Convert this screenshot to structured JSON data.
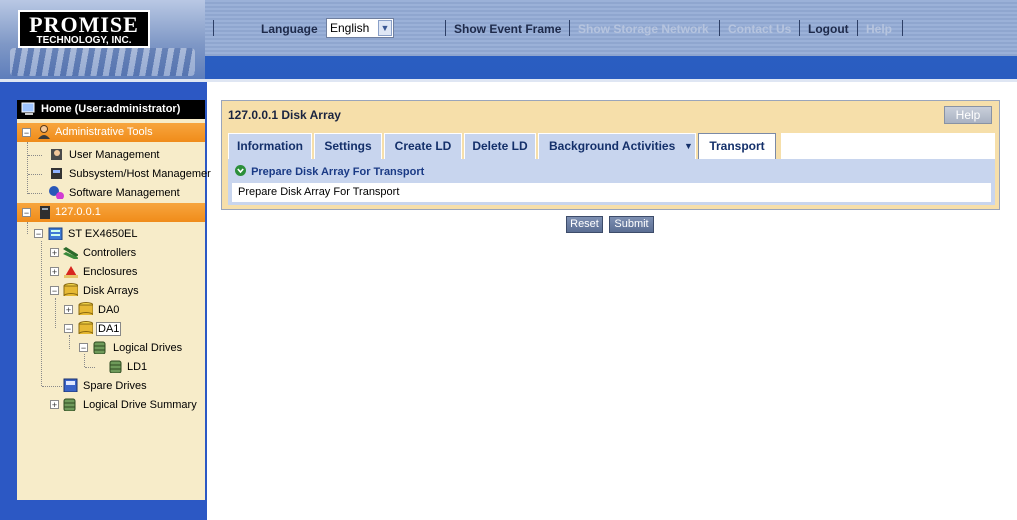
{
  "header": {
    "logo": {
      "line1": "PROMISE",
      "line2": "TECHNOLOGY, INC."
    },
    "language_label": "Language",
    "language_value": "English",
    "nav": [
      {
        "label": "Show Event Frame",
        "enabled": true
      },
      {
        "label": "Show Storage Network",
        "enabled": false
      },
      {
        "label": "Contact Us",
        "enabled": false
      },
      {
        "label": "Logout",
        "enabled": true
      },
      {
        "label": "Help",
        "enabled": false
      }
    ]
  },
  "sidebar": {
    "home": "Home (User:administrator)",
    "admin_tools": "Administrative Tools",
    "admin_items": [
      "User Management",
      "Subsystem/Host Managemer",
      "Software Management"
    ],
    "host": "127.0.0.1",
    "tree": {
      "subsystem": "ST EX4650EL",
      "controllers": "Controllers",
      "enclosures": "Enclosures",
      "disk_arrays": "Disk Arrays",
      "da0": "DA0",
      "da1": "DA1",
      "logical_drives": "Logical Drives",
      "ld1": "LD1",
      "spare_drives": "Spare Drives",
      "ld_summary": "Logical Drive Summary"
    }
  },
  "panel": {
    "title": "127.0.0.1 Disk Array",
    "help_label": "Help",
    "tabs": [
      {
        "label": "Information",
        "active": false
      },
      {
        "label": "Settings",
        "active": false
      },
      {
        "label": "Create LD",
        "active": false
      },
      {
        "label": "Delete LD",
        "active": false
      },
      {
        "label": "Background Activities",
        "active": false,
        "dropdown": true
      },
      {
        "label": "Transport",
        "active": true
      }
    ],
    "section_title": "Prepare Disk Array For Transport",
    "section_text": "Prepare Disk Array For Transport"
  },
  "buttons": {
    "reset": "Reset",
    "submit": "Submit"
  },
  "colors": {
    "header_blue": "#2b5fc2",
    "tree_bg": "#f7ecc9",
    "orange": "#f08c1a",
    "panel_bg": "#f6dfaa",
    "tab_bg": "#c8d5ee"
  }
}
